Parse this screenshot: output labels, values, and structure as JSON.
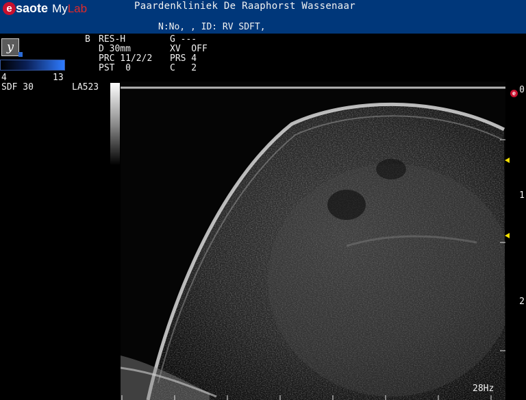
{
  "header": {
    "brand": "saote",
    "brand_e": "e",
    "product_my": "My",
    "product_lab": "Lab",
    "clinic": "Paardenkliniek De Raaphorst Wassenaar",
    "patient_line": "N:No, , ID: RV SDFT,"
  },
  "params": {
    "mode": "B",
    "res": "RES-H",
    "gain": "G ---",
    "depth": "D 30mm",
    "xview": "XV  OFF",
    "prc": "PRC 11/2/2",
    "prs": "PRS 4",
    "pst": "PST  0",
    "c": "C   2"
  },
  "left_panel": {
    "y_icon_glyph": "y",
    "freq_low": "4",
    "freq_high": "13",
    "preset": "SDF 30",
    "probe": "LA523"
  },
  "depth_scale": {
    "marks": [
      "0",
      "1",
      "2"
    ]
  },
  "focus_markers": 2,
  "orientation_glyph": "e",
  "frame_rate": "28Hz",
  "colors": {
    "header_bg": "#00377a",
    "brand_red": "#c8102e",
    "focus_marker": "#f5e000",
    "gain_bar": "#2e7bff"
  }
}
